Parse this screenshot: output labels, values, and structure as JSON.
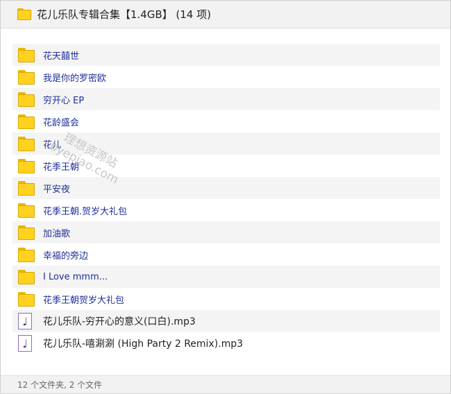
{
  "header": {
    "title": "花儿乐队专辑合集【1.4GB】 (14 项)",
    "icon": "folder-icon"
  },
  "items": [
    {
      "name": "花天囍世",
      "type": "folder",
      "icon": "folder-icon"
    },
    {
      "name": "我是你的罗密欧",
      "type": "folder",
      "icon": "folder-icon"
    },
    {
      "name": "穷开心 EP",
      "type": "folder",
      "icon": "folder-icon"
    },
    {
      "name": "花龄盛会",
      "type": "folder",
      "icon": "folder-icon"
    },
    {
      "name": "花儿",
      "type": "folder",
      "icon": "folder-icon"
    },
    {
      "name": "花季王朝",
      "type": "folder",
      "icon": "folder-icon"
    },
    {
      "name": "平安夜",
      "type": "folder",
      "icon": "folder-icon"
    },
    {
      "name": "花季王朝.贺岁大礼包",
      "type": "folder",
      "icon": "folder-icon"
    },
    {
      "name": "加油歌",
      "type": "folder",
      "icon": "folder-icon"
    },
    {
      "name": "幸福的旁边",
      "type": "folder",
      "icon": "folder-icon"
    },
    {
      "name": "I Love mmm...",
      "type": "folder",
      "icon": "folder-icon"
    },
    {
      "name": "花季王朝贺岁大礼包",
      "type": "folder",
      "icon": "folder-icon"
    },
    {
      "name": "花儿乐队-穷开心的意义(口白).mp3",
      "type": "file",
      "icon": "audio-file-icon"
    },
    {
      "name": "花儿乐队-嘻涮涮 (High Party 2 Remix).mp3",
      "type": "file",
      "icon": "audio-file-icon"
    }
  ],
  "watermark": {
    "line1": "理想资源站",
    "line2": "byepiao.com"
  },
  "footer": {
    "summary": "12 个文件夹, 2 个文件"
  },
  "colors": {
    "folder": "#ffd21f",
    "folder_link": "#1f2f9a",
    "header_bg": "#f2f2f2"
  }
}
